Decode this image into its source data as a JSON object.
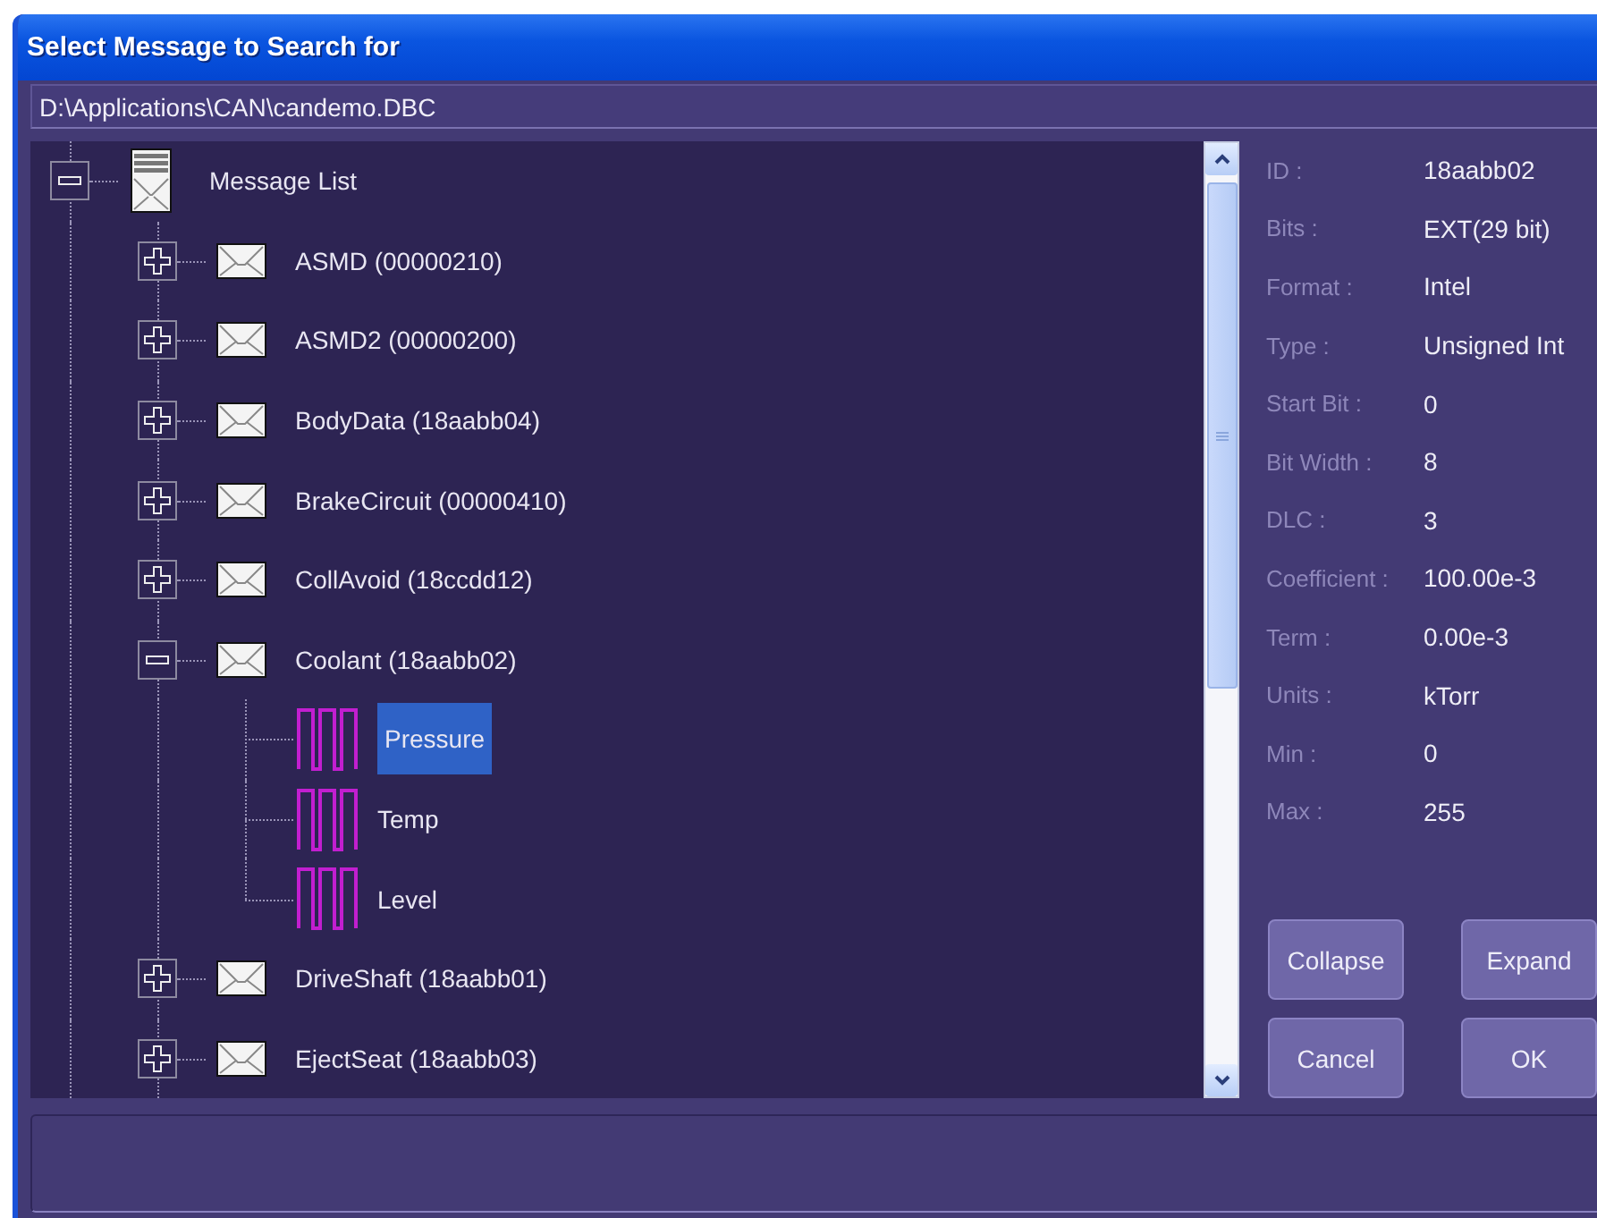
{
  "window": {
    "title": "Select Message to Search for"
  },
  "path": "D:\\Applications\\CAN\\candemo.DBC",
  "tree": {
    "kind": "list",
    "label": "Message List",
    "expanded": true,
    "selected": false,
    "children": [
      {
        "kind": "message",
        "label": "ASMD (00000210)",
        "expanded": false,
        "selected": false
      },
      {
        "kind": "message",
        "label": "ASMD2 (00000200)",
        "expanded": false,
        "selected": false
      },
      {
        "kind": "message",
        "label": "BodyData (18aabb04)",
        "expanded": false,
        "selected": false
      },
      {
        "kind": "message",
        "label": "BrakeCircuit (00000410)",
        "expanded": false,
        "selected": false
      },
      {
        "kind": "message",
        "label": "CollAvoid (18ccdd12)",
        "expanded": false,
        "selected": false
      },
      {
        "kind": "message",
        "label": "Coolant (18aabb02)",
        "expanded": true,
        "selected": false,
        "children": [
          {
            "kind": "signal",
            "label": "Pressure",
            "selected": true
          },
          {
            "kind": "signal",
            "label": "Temp",
            "selected": false
          },
          {
            "kind": "signal",
            "label": "Level",
            "selected": false
          }
        ]
      },
      {
        "kind": "message",
        "label": "DriveShaft (18aabb01)",
        "expanded": false,
        "selected": false
      },
      {
        "kind": "message",
        "label": "EjectSeat (18aabb03)",
        "expanded": false,
        "selected": false
      }
    ]
  },
  "details": [
    {
      "label": "ID :",
      "value": "18aabb02"
    },
    {
      "label": "Bits :",
      "value": "EXT(29 bit)"
    },
    {
      "label": "Format :",
      "value": "Intel"
    },
    {
      "label": "Type :",
      "value": "Unsigned Int"
    },
    {
      "label": "Start Bit :",
      "value": "0"
    },
    {
      "label": "Bit Width :",
      "value": "8"
    },
    {
      "label": "DLC :",
      "value": "3"
    },
    {
      "label": "Coefficient :",
      "value": "100.00e-3"
    },
    {
      "label": "Term :",
      "value": "0.00e-3"
    },
    {
      "label": "Units :",
      "value": "kTorr"
    },
    {
      "label": "Min :",
      "value": "0"
    },
    {
      "label": "Max :",
      "value": "255"
    }
  ],
  "buttons": [
    "Collapse",
    "Expand",
    "Cancel",
    "OK"
  ]
}
